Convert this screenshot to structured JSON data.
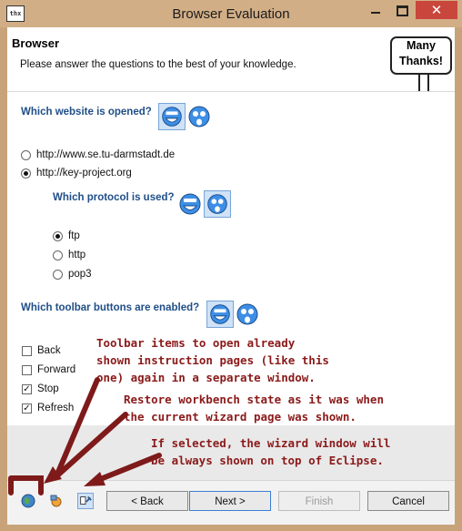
{
  "window": {
    "title": "Browser Evaluation",
    "app_icon_text": "thx",
    "close_glyph": "✕"
  },
  "header": {
    "title": "Browser",
    "subtitle": "Please answer the questions to the best of your knowledge.",
    "bubble_line1": "Many",
    "bubble_line2": "Thanks!"
  },
  "questions": {
    "q1": {
      "label": "Which website is opened?",
      "options": [
        {
          "label": "http://www.se.tu-darmstadt.de",
          "selected": false
        },
        {
          "label": "http://key-project.org",
          "selected": true
        }
      ]
    },
    "q2": {
      "label": "Which protocol is used?",
      "options": [
        {
          "label": "ftp",
          "selected": true
        },
        {
          "label": "http",
          "selected": false
        },
        {
          "label": "pop3",
          "selected": false
        }
      ]
    },
    "q3": {
      "label": "Which toolbar buttons are enabled?",
      "options": [
        {
          "label": "Back",
          "checked": false
        },
        {
          "label": "Forward",
          "checked": false
        },
        {
          "label": "Stop",
          "checked": true
        },
        {
          "label": "Refresh",
          "checked": true
        }
      ]
    }
  },
  "annotations": {
    "a1": "Toolbar items to open already\nshown instruction pages (like this\none) again in a separate window.",
    "a2": "Restore workbench state as it was when\nthe current wizard page was shown.",
    "a3": "If selected, the wizard window will\nbe always shown on top of Eclipse."
  },
  "buttons": {
    "back": "< Back",
    "next": "Next >",
    "finish": "Finish",
    "cancel": "Cancel"
  },
  "toolbar_icons": [
    "globe-icon",
    "restore-icon",
    "pin-on-top-icon"
  ],
  "colors": {
    "question_text": "#1f4e87",
    "annotation_text": "#8b1a1a",
    "window_frame": "#c8a37a",
    "close_button": "#c9463d"
  }
}
